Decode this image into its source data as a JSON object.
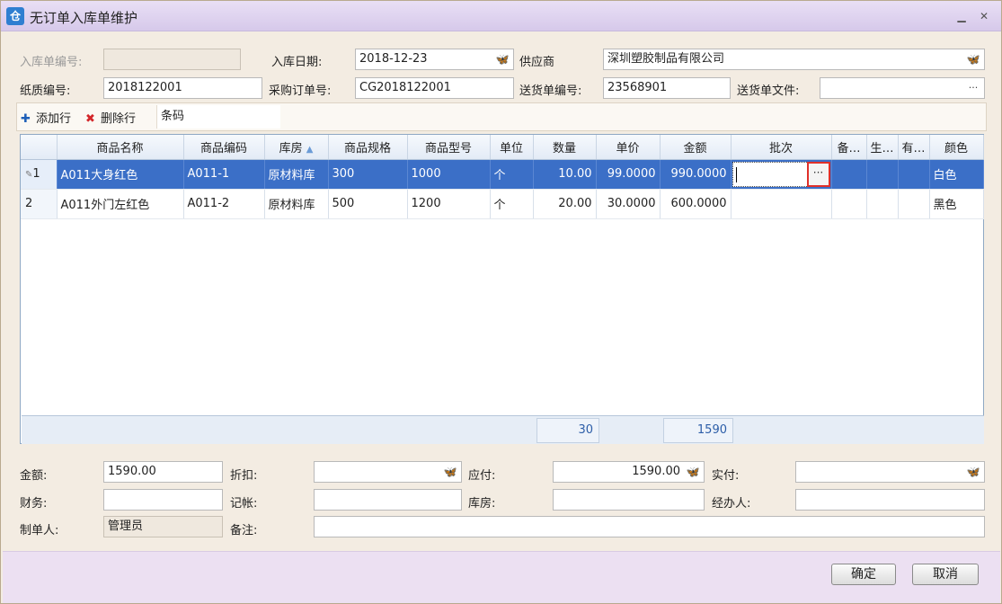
{
  "window": {
    "icon_glyph": "仓",
    "title": "无订单入库单维护"
  },
  "header": {
    "inbound_no_label": "入库单编号:",
    "inbound_no_value": "",
    "inbound_date_label": "入库日期:",
    "inbound_date_value": "2018-12-23",
    "supplier_label": "供应商",
    "supplier_value": "深圳塑胶制品有限公司",
    "paper_no_label": "纸质编号:",
    "paper_no_value": "2018122001",
    "po_no_label": "采购订单号:",
    "po_no_value": "CG2018122001",
    "delivery_no_label": "送货单编号:",
    "delivery_no_value": "23568901",
    "delivery_file_label": "送货单文件:",
    "delivery_file_value": ""
  },
  "toolbar": {
    "add_row_label": "添加行",
    "delete_row_label": "删除行",
    "barcode_label": "条码"
  },
  "grid": {
    "columns": [
      "商品名称",
      "商品编码",
      "库房",
      "商品规格",
      "商品型号",
      "单位",
      "数量",
      "单价",
      "金额",
      "批次",
      "备…",
      "生…",
      "有…",
      "颜色"
    ],
    "rows": [
      {
        "no": "1",
        "name": "A011大身红色",
        "code": "A011-1",
        "warehouse": "原材料库",
        "spec": "300",
        "model": "1000",
        "unit": "个",
        "qty": "10.00",
        "price": "99.0000",
        "amount": "990.0000",
        "batch": "",
        "note": "",
        "prod": "",
        "valid": "",
        "color": "白色"
      },
      {
        "no": "2",
        "name": "A011外门左红色",
        "code": "A011-2",
        "warehouse": "原材料库",
        "spec": "500",
        "model": "1200",
        "unit": "个",
        "qty": "20.00",
        "price": "30.0000",
        "amount": "600.0000",
        "batch": "",
        "note": "",
        "prod": "",
        "valid": "",
        "color": "黑色"
      }
    ],
    "footer_qty": "30",
    "footer_amount": "1590"
  },
  "summary": {
    "amount_label": "金额:",
    "amount_value": "1590.00",
    "discount_label": "折扣:",
    "discount_value": "",
    "payable_label": "应付:",
    "payable_value": "1590.00",
    "actual_label": "实付:",
    "actual_value": "",
    "finance_label": "财务:",
    "finance_value": "",
    "bookkeep_label": "记帐:",
    "bookkeep_value": "",
    "warehouse_label": "库房:",
    "warehouse_value": "",
    "handler_label": "经办人:",
    "handler_value": "",
    "creator_label": "制单人:",
    "creator_value": "管理员",
    "remark_label": "备注:",
    "remark_value": ""
  },
  "buttons": {
    "ok_label": "确定",
    "cancel_label": "取消"
  },
  "colors": {
    "selected_row": "#3b6fc7",
    "highlight_box": "#e0302a"
  }
}
